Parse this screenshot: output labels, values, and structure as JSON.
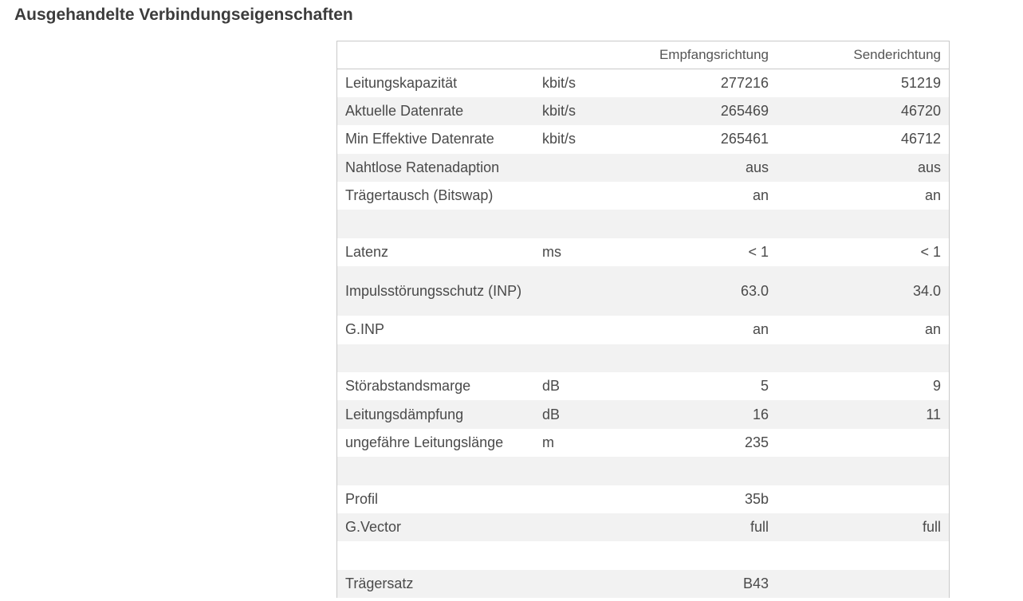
{
  "page_title": "Ausgehandelte Verbindungseigenschaften",
  "table": {
    "headers": [
      "",
      "",
      "Empfangsrichtung",
      "Senderichtung"
    ],
    "rows": [
      {
        "label": "Leitungskapazität",
        "unit": "kbit/s",
        "down": "277216",
        "up": "51219"
      },
      {
        "label": "Aktuelle Datenrate",
        "unit": "kbit/s",
        "down": "265469",
        "up": "46720"
      },
      {
        "label": "Min Effektive Datenrate",
        "unit": "kbit/s",
        "down": "265461",
        "up": "46712"
      },
      {
        "label": "Nahtlose Ratenadaption",
        "unit": "",
        "down": "aus",
        "up": "aus"
      },
      {
        "label": "Trägertausch (Bitswap)",
        "unit": "",
        "down": "an",
        "up": "an"
      },
      {
        "label": "",
        "unit": "",
        "down": "",
        "up": ""
      },
      {
        "label": "Latenz",
        "unit": "ms",
        "down": "< 1",
        "up": "< 1"
      },
      {
        "label": "Impulsstörungsschutz (INP)",
        "unit": "",
        "down": "63.0",
        "up": "34.0"
      },
      {
        "label": "G.INP",
        "unit": "",
        "down": "an",
        "up": "an"
      },
      {
        "label": "",
        "unit": "",
        "down": "",
        "up": ""
      },
      {
        "label": "Störabstandsmarge",
        "unit": "dB",
        "down": "5",
        "up": "9"
      },
      {
        "label": "Leitungsdämpfung",
        "unit": "dB",
        "down": "16",
        "up": "11"
      },
      {
        "label": "ungefähre Leitungslänge",
        "unit": "m",
        "down": "235",
        "up": ""
      },
      {
        "label": "",
        "unit": "",
        "down": "",
        "up": ""
      },
      {
        "label": "Profil",
        "unit": "",
        "down": "35b",
        "up": ""
      },
      {
        "label": "G.Vector",
        "unit": "",
        "down": "full",
        "up": "full"
      },
      {
        "label": "",
        "unit": "",
        "down": "",
        "up": ""
      },
      {
        "label": "Trägersatz",
        "unit": "",
        "down": "B43",
        "up": ""
      }
    ]
  }
}
